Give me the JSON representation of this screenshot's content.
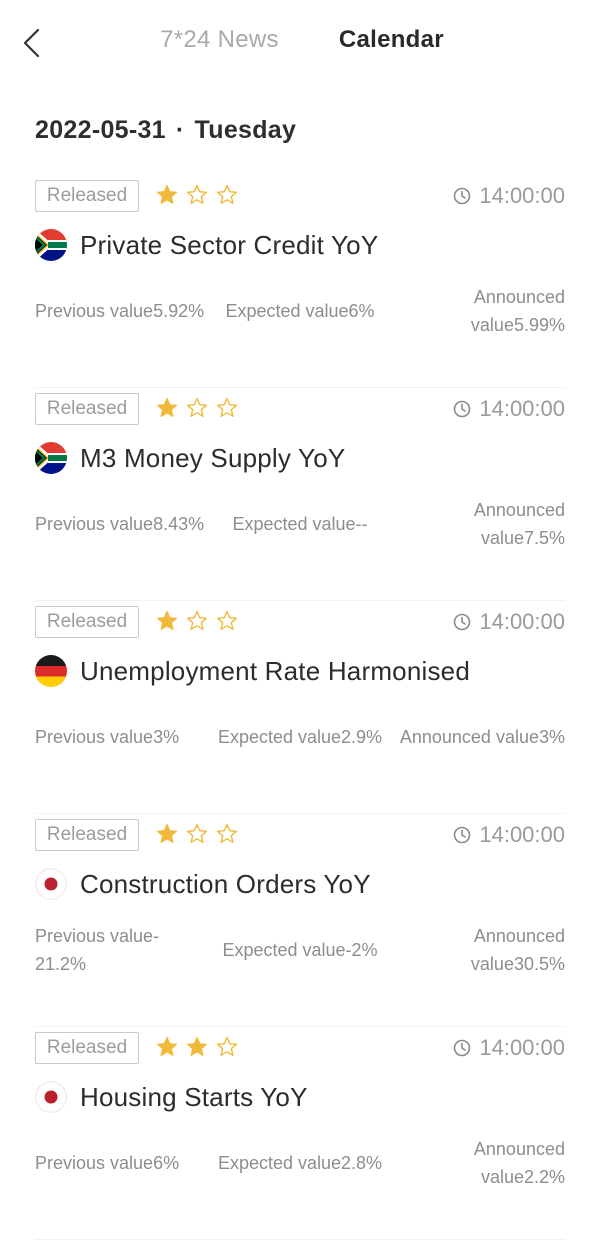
{
  "header": {
    "tabs": [
      {
        "label": "7*24 News",
        "active": false
      },
      {
        "label": "Calendar",
        "active": true
      }
    ]
  },
  "date": {
    "day": "2022-05-31",
    "separator": "·",
    "weekday": "Tuesday"
  },
  "colors": {
    "star": "#f1b93a",
    "accent_text": "#2a2a2a",
    "muted": "#9a9a9a"
  },
  "events": [
    {
      "status": "Released",
      "stars": 1,
      "time": "14:00:00",
      "flag": "south-africa-flag",
      "name": "Private Sector Credit YoY",
      "previous": "Previous value5.92%",
      "expected": "Expected value6%",
      "announced": "Announced value5.99%"
    },
    {
      "status": "Released",
      "stars": 1,
      "time": "14:00:00",
      "flag": "south-africa-flag",
      "name": "M3 Money Supply YoY",
      "previous": "Previous value8.43%",
      "expected": "Expected value--",
      "announced": "Announced value7.5%"
    },
    {
      "status": "Released",
      "stars": 1,
      "time": "14:00:00",
      "flag": "germany-flag",
      "name": "Unemployment Rate Harmonised",
      "previous": "Previous value3%",
      "expected": "Expected value2.9%",
      "announced": "Announced value3%"
    },
    {
      "status": "Released",
      "stars": 1,
      "time": "14:00:00",
      "flag": "japan-flag",
      "name": "Construction Orders YoY",
      "previous": "Previous value-21.2%",
      "expected": "Expected value-2%",
      "announced": "Announced value30.5%"
    },
    {
      "status": "Released",
      "stars": 2,
      "time": "14:00:00",
      "flag": "japan-flag",
      "name": "Housing Starts YoY",
      "previous": "Previous value6%",
      "expected": "Expected value2.8%",
      "announced": "Announced value2.2%"
    }
  ]
}
